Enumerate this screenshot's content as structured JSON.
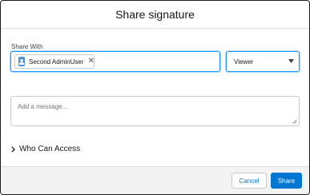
{
  "modal": {
    "title": "Share signature"
  },
  "share_with": {
    "label": "Share With",
    "pill": {
      "icon": "user-icon",
      "name": "Second AdminUser",
      "remove_icon": "close-icon",
      "remove_glyph": "✕"
    }
  },
  "access_select": {
    "value": "Viewer",
    "icon": "caret-down-icon"
  },
  "message": {
    "placeholder": "Add a message...",
    "value": ""
  },
  "who_can_access": {
    "label": "Who Can Access",
    "icon": "chevron-right-icon"
  },
  "footer": {
    "cancel_label": "Cancel",
    "share_label": "Share"
  },
  "colors": {
    "brand": "#0176d3",
    "focus_border": "#1b96ff",
    "avatar": "#4f8fd8",
    "footer_bg": "#f3f3f3"
  }
}
